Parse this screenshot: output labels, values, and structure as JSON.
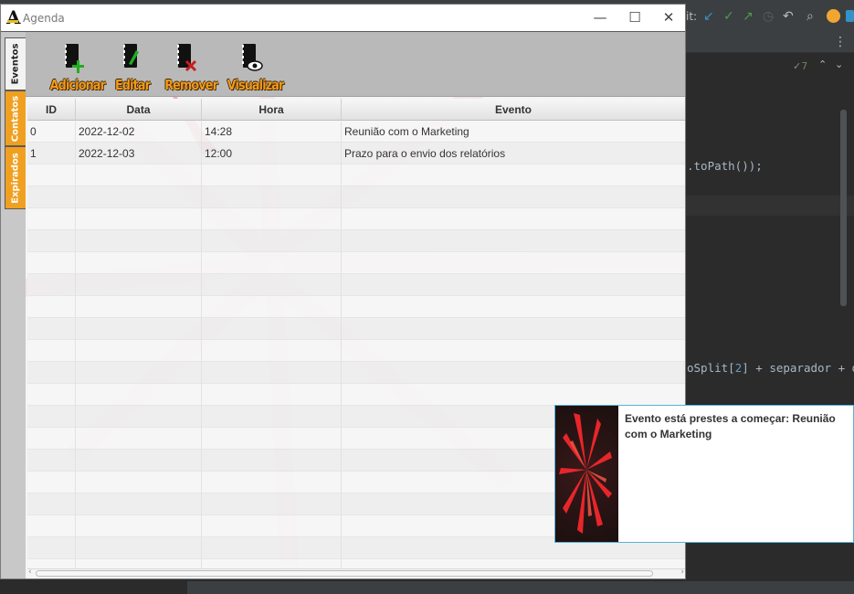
{
  "ide": {
    "git_label": "it:",
    "code_line_1": ".toPath());",
    "code_line_2_a": "oSplit[",
    "code_line_2_index": "2",
    "code_line_2_b": "] + separador + dad",
    "inspection_count": "7",
    "icons": [
      "git-update-icon",
      "git-commit-icon",
      "git-push-icon",
      "history-icon",
      "rollback-icon",
      "search-icon",
      "update-icon",
      "plugin-icon",
      "more-icon"
    ]
  },
  "window": {
    "title": "Agenda",
    "logo": "A",
    "controls": {
      "minimize": "—",
      "maximize": "☐",
      "close": "✕"
    }
  },
  "tabs": [
    {
      "label": "Eventos",
      "active": true
    },
    {
      "label": "Contatos",
      "active": false
    },
    {
      "label": "Expirados",
      "active": false
    }
  ],
  "toolbar": {
    "add_label": "Adicionar",
    "edit_label": "Editar",
    "remove_label": "Remover",
    "view_label": "Visualizar"
  },
  "table": {
    "headers": [
      "ID",
      "Data",
      "Hora",
      "Evento"
    ],
    "rows": [
      [
        "0",
        "2022-12-02",
        "14:28",
        "Reunião com o Marketing"
      ],
      [
        "1",
        "2022-12-03",
        "12:00",
        "Prazo para o envio dos relatórios"
      ]
    ]
  },
  "scrollbar": {
    "left_arrow": "‹",
    "right_arrow": "›"
  },
  "notification": {
    "message": "Evento está prestes a começar: Reunião com o Marketing"
  },
  "colors": {
    "tab_accent": "#f0a020",
    "toolbar_label": "#f29a1c",
    "notification_border": "#56b3d9"
  }
}
